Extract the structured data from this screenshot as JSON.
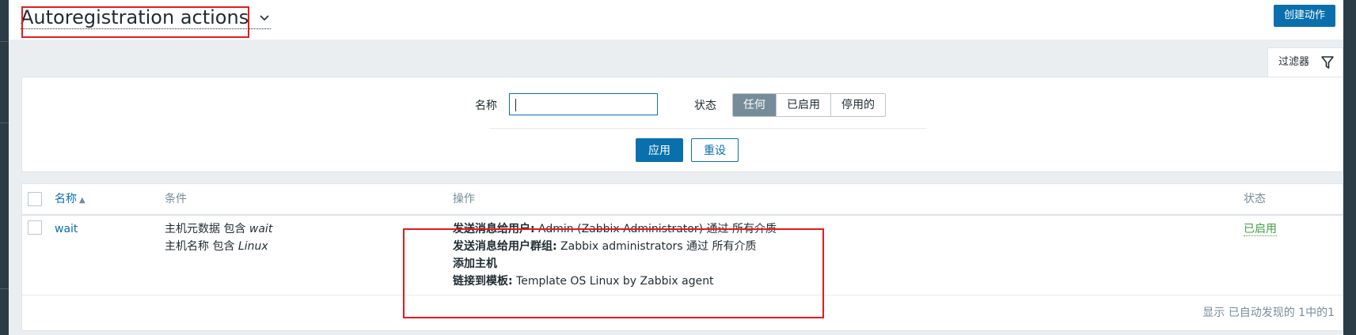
{
  "header": {
    "title": "Autoregistration actions",
    "create_button": "创建动作"
  },
  "filter": {
    "tab_label": "过滤器",
    "name_label": "名称",
    "name_value": "",
    "status_label": "状态",
    "status_options": [
      "任何",
      "已启用",
      "停用的"
    ],
    "status_selected": "任何",
    "apply_button": "应用",
    "reset_button": "重设"
  },
  "table": {
    "headers": {
      "name": "名称",
      "conditions": "条件",
      "operations": "操作",
      "status": "状态"
    },
    "rows": [
      {
        "name": "wait",
        "conditions": [
          {
            "prefix": "主机元数据 包含 ",
            "value": "wait"
          },
          {
            "prefix": "主机名称 包含 ",
            "value": "Linux"
          }
        ],
        "operations": [
          {
            "label": "发送消息给用户:",
            "text": " Admin (Zabbix Administrator) 通过 所有介质"
          },
          {
            "label": "发送消息给用户群组:",
            "text": " Zabbix administrators 通过 所有介质"
          },
          {
            "label": "添加主机",
            "text": ""
          },
          {
            "label": "链接到模板:",
            "text": " Template OS Linux by Zabbix agent"
          }
        ],
        "status": "已启用"
      }
    ],
    "footer": "显示 已自动发现的 1中的1"
  },
  "colors": {
    "accent": "#0a70ad",
    "enabled": "#429e47",
    "highlight_box": "#e31b1b"
  }
}
